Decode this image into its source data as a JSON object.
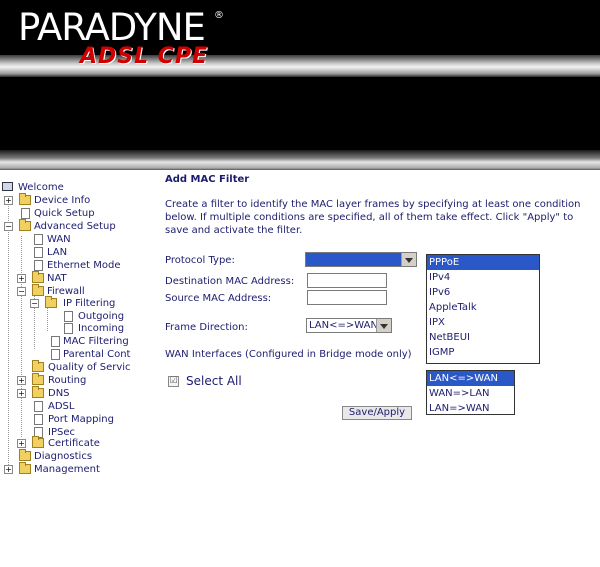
{
  "header": {
    "brand": "PARADYNE",
    "registered": "®",
    "product": "ADSL CPE"
  },
  "nav": {
    "items": [
      {
        "label": "Welcome"
      },
      {
        "label": "Device Info"
      },
      {
        "label": "Quick Setup"
      },
      {
        "label": "Advanced Setup"
      },
      {
        "label": "WAN"
      },
      {
        "label": "LAN"
      },
      {
        "label": "Ethernet Mode"
      },
      {
        "label": "NAT"
      },
      {
        "label": "Firewall"
      },
      {
        "label": "IP Filtering"
      },
      {
        "label": "Outgoing"
      },
      {
        "label": "Incoming"
      },
      {
        "label": "MAC Filtering"
      },
      {
        "label": "Parental Cont"
      },
      {
        "label": "Quality of Servic"
      },
      {
        "label": "Routing"
      },
      {
        "label": "DNS"
      },
      {
        "label": "ADSL"
      },
      {
        "label": "Port Mapping"
      },
      {
        "label": "IPSec"
      },
      {
        "label": "Certificate"
      },
      {
        "label": "Diagnostics"
      },
      {
        "label": "Management"
      }
    ]
  },
  "content": {
    "title": "Add MAC Filter",
    "description": "Create a filter to identify the MAC layer frames by specifying at least one condition below. If multiple conditions are specified, all of them take effect. Click \"Apply\" to save and activate the filter.",
    "protocol_label": "Protocol Type:",
    "protocol_value": "",
    "protocol_options": [
      "PPPoE",
      "IPv4",
      "IPv6",
      "AppleTalk",
      "IPX",
      "NetBEUI",
      "IGMP"
    ],
    "dest_mac_label": "Destination MAC Address:",
    "dest_mac_value": "",
    "src_mac_label": "Source MAC Address:",
    "src_mac_value": "",
    "direction_label": "Frame Direction:",
    "direction_value": "LAN<=>WAN",
    "direction_options": [
      "LAN<=>WAN",
      "WAN=>LAN",
      "LAN=>WAN"
    ],
    "wan_label": "WAN Interfaces (Configured in Bridge mode only)",
    "select_all_label": "Select All",
    "select_all_checked": true,
    "check_glyph": "☑",
    "save_label": "Save/Apply"
  }
}
